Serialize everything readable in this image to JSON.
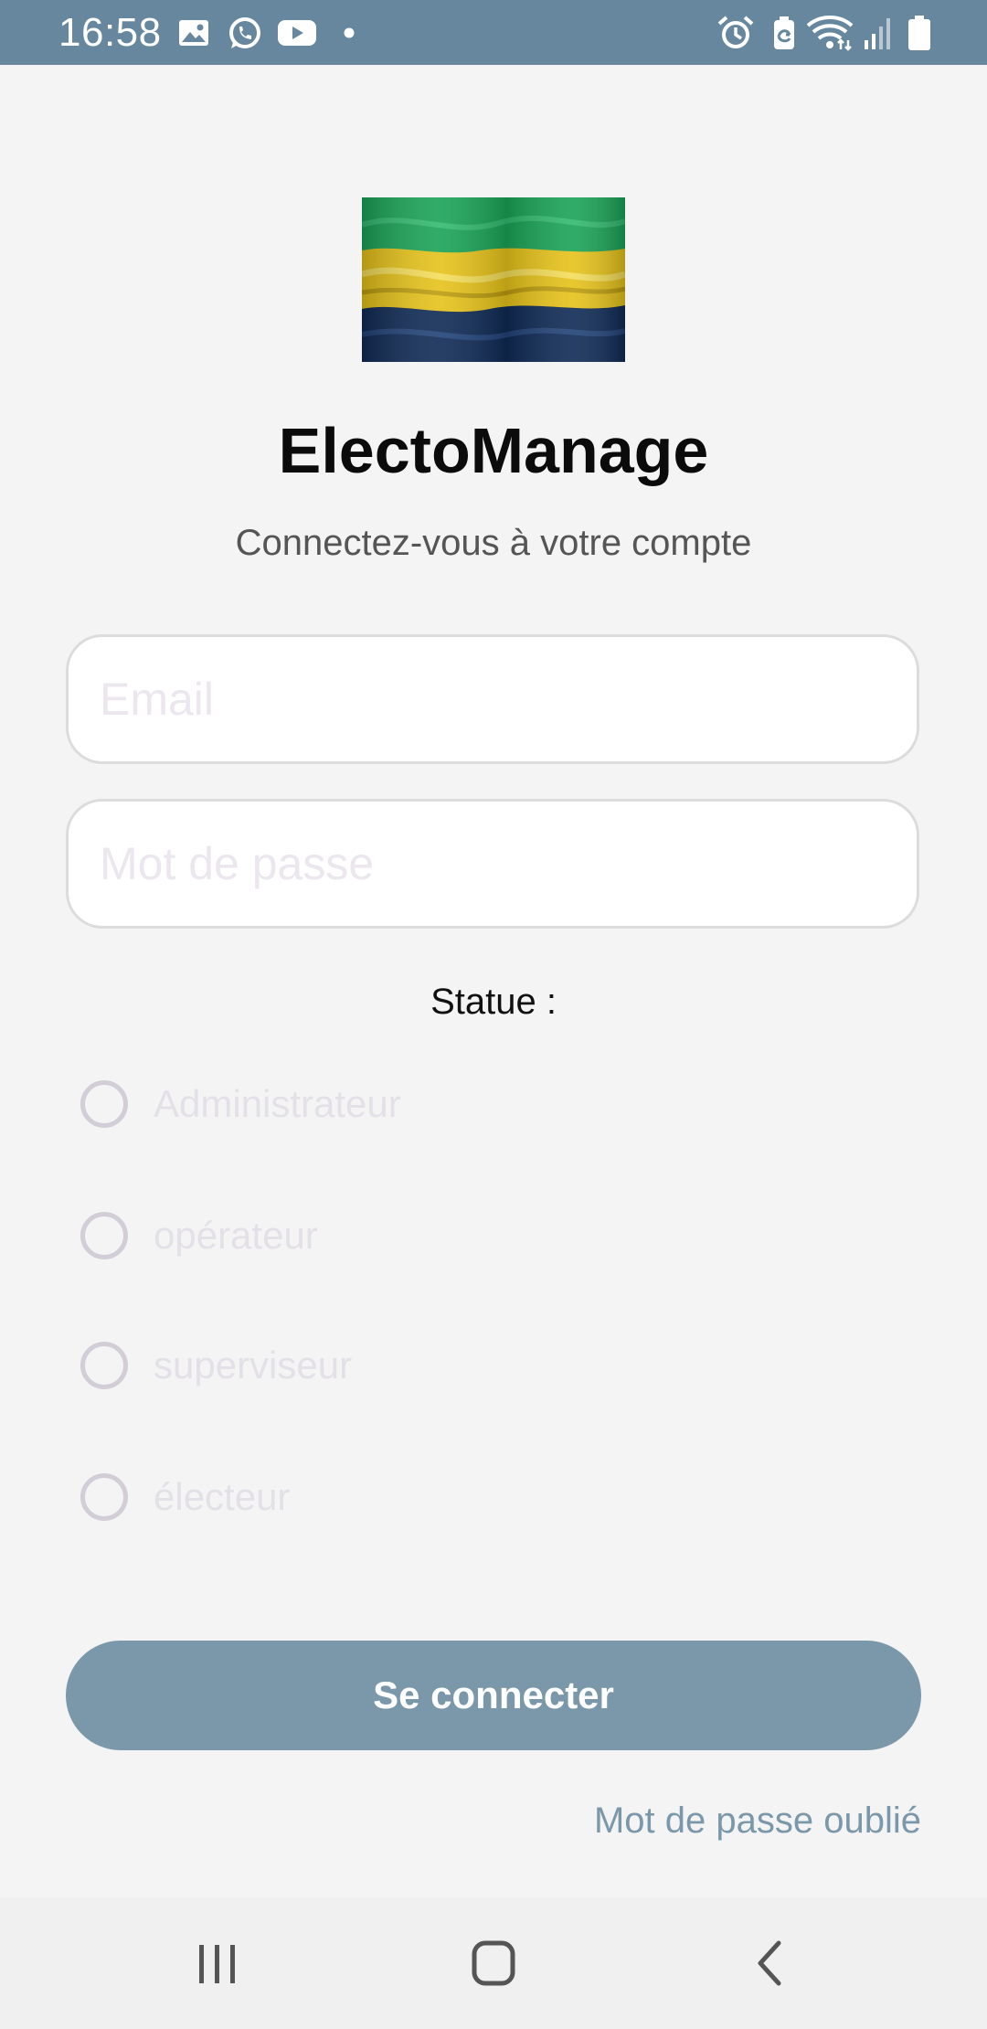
{
  "status_bar": {
    "time": "16:58",
    "left_icons": [
      "gallery-icon",
      "whatsapp-icon",
      "youtube-icon",
      "dot-icon"
    ],
    "right_icons": [
      "alarm-icon",
      "battery-saver-icon",
      "wifi-icon",
      "signal-icon",
      "battery-icon"
    ],
    "background_color": "#67879e"
  },
  "app": {
    "logo": "gabon-flag",
    "title": "ElectoManage",
    "subtitle": "Connectez-vous à votre compte"
  },
  "form": {
    "email_placeholder": "Email",
    "email_value": "",
    "password_placeholder": "Mot de passe",
    "password_value": "",
    "status_label": "Statue :",
    "role_options": [
      "Administrateur",
      "opérateur",
      "superviseur",
      "électeur"
    ],
    "selected_role": null,
    "login_button": "Se connecter",
    "forgot_password": "Mot de passe oublié",
    "accent_color": "#7a98aa"
  },
  "nav_bar": {
    "buttons": [
      "recent-apps-icon",
      "home-icon",
      "back-icon"
    ]
  }
}
